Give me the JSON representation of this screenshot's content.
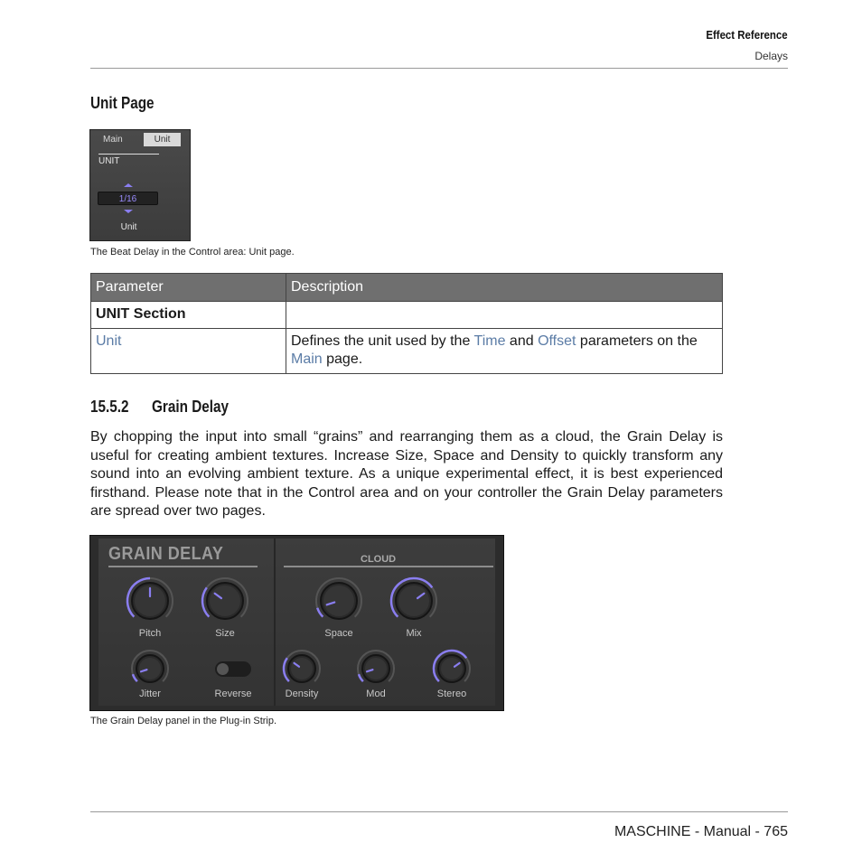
{
  "header": {
    "section": "Effect Reference",
    "subsection": "Delays"
  },
  "unit_page": {
    "heading": "Unit Page",
    "widget": {
      "tabs": [
        "Main",
        "Unit"
      ],
      "active_tab": "Unit",
      "section_label": "UNIT",
      "value": "1/16",
      "param_name": "Unit",
      "accent_color": "#9a8cff"
    },
    "caption": "The Beat Delay in the Control area: Unit page."
  },
  "table": {
    "headers": [
      "Parameter",
      "Description"
    ],
    "section_row": "UNIT Section",
    "rows": [
      {
        "param": "Unit",
        "desc_parts": [
          "Defines the unit used by the ",
          "Time",
          " and ",
          "Offset",
          " parameters on the ",
          "Main",
          " page."
        ]
      }
    ]
  },
  "grain_delay": {
    "heading_number": "15.5.2",
    "heading_title": "Grain Delay",
    "paragraph": "By chopping the input into small “grains” and rearranging them as a cloud, the Grain Delay is useful for creating ambient textures. Increase Size, Space and Density to quickly transform any sound into an evolving ambient texture. As a unique experimental effect, it is best experienced firsthand. Please note that in the Control area and on your controller the Grain Delay parameters are spread over two pages.",
    "panel": {
      "title": "GRAIN DELAY",
      "cloud_label": "CLOUD",
      "knobs": [
        {
          "label": "Pitch",
          "value": 0.5
        },
        {
          "label": "Size",
          "value": 0.3
        },
        {
          "label": "Jitter",
          "value": 0.1
        },
        {
          "label": "Space",
          "value": 0.1
        },
        {
          "label": "Mix",
          "value": 0.7
        },
        {
          "label": "Density",
          "value": 0.3
        },
        {
          "label": "Mod",
          "value": 0.1
        },
        {
          "label": "Stereo",
          "value": 0.7
        }
      ],
      "reverse_label": "Reverse",
      "reverse_on": false,
      "accent_color": "#8a7ef0"
    },
    "caption": "The Grain Delay panel in the Plug-in Strip."
  },
  "footer": {
    "text": "MASCHINE - Manual - 765"
  }
}
